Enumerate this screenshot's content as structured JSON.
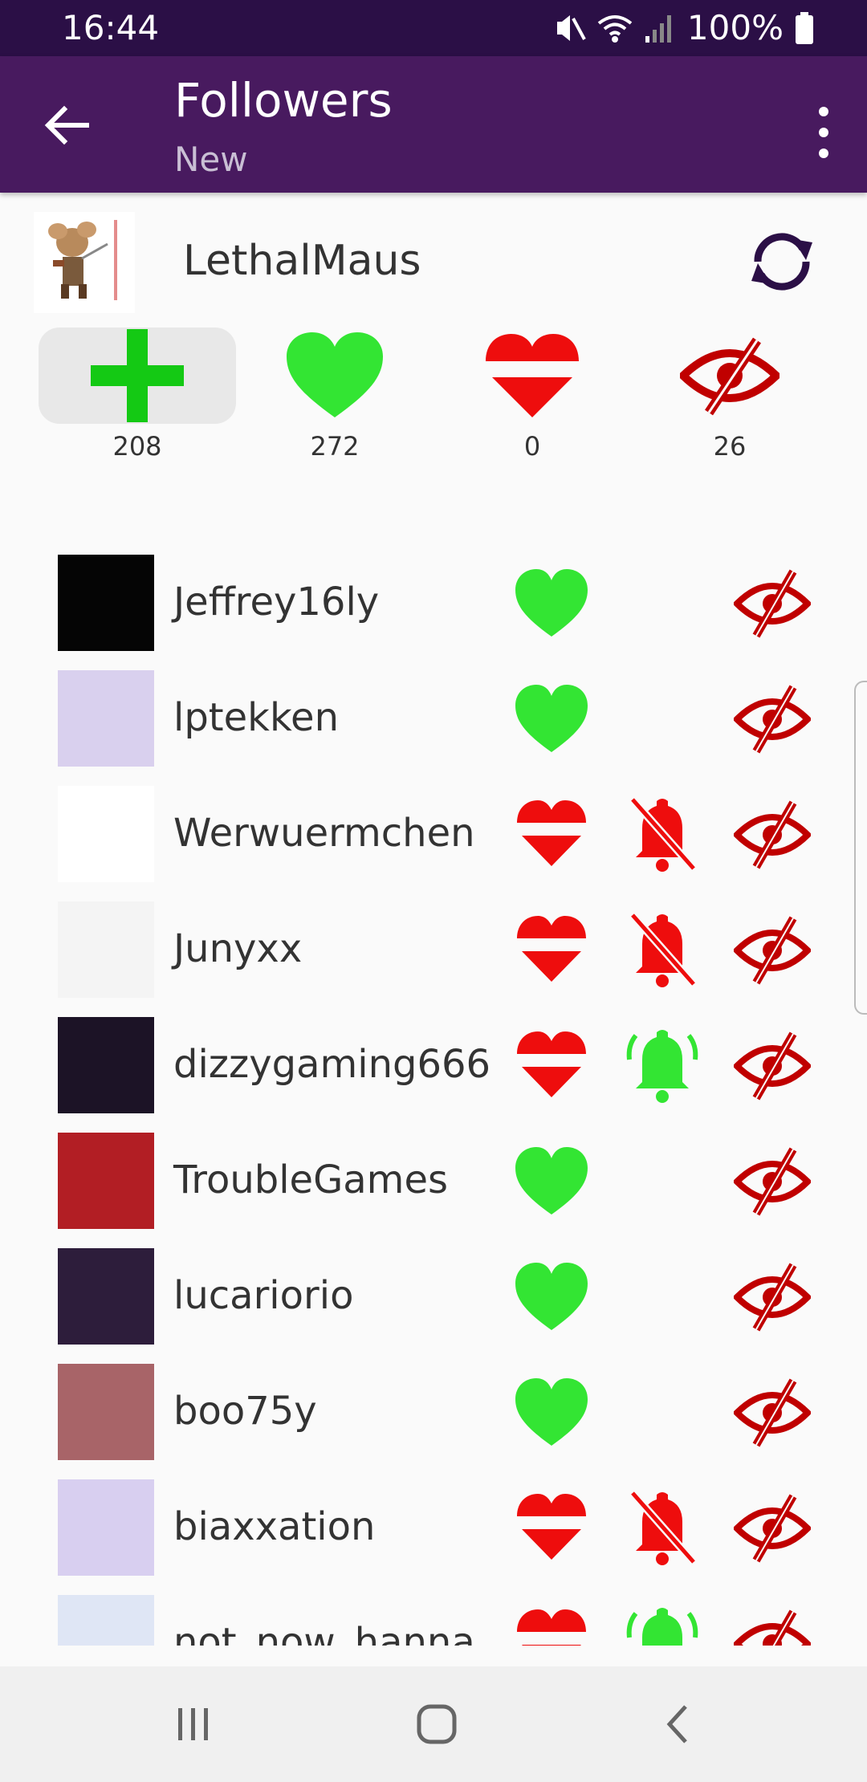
{
  "status_bar": {
    "time": "16:44",
    "battery": "100%"
  },
  "app_bar": {
    "title": "Followers",
    "subtitle": "New"
  },
  "profile": {
    "name": "LethalMaus",
    "stats": [
      {
        "key": "new",
        "count": "208"
      },
      {
        "key": "following-back",
        "count": "272"
      },
      {
        "key": "not-following",
        "count": "0"
      },
      {
        "key": "excluded",
        "count": "26"
      }
    ]
  },
  "followers": [
    {
      "name": "Jeffrey16ly",
      "heart": "follow",
      "bell": "none",
      "avatar_color": "#050505"
    },
    {
      "name": "lptekken",
      "heart": "follow",
      "bell": "none",
      "avatar_color": "#d9d0ee"
    },
    {
      "name": "Werwuermchen",
      "heart": "unfollow",
      "bell": "off",
      "avatar_color": "#ffffff"
    },
    {
      "name": "Junyxx",
      "heart": "unfollow",
      "bell": "off",
      "avatar_color": "#f4f4f4"
    },
    {
      "name": "dizzygaming666",
      "heart": "unfollow",
      "bell": "on",
      "avatar_color": "#1c1326"
    },
    {
      "name": "TroubleGames",
      "heart": "follow",
      "bell": "none",
      "avatar_color": "#b21e24"
    },
    {
      "name": "lucariorio",
      "heart": "follow",
      "bell": "none",
      "avatar_color": "#2d1d3b"
    },
    {
      "name": "boo75y",
      "heart": "follow",
      "bell": "none",
      "avatar_color": "#a86468"
    },
    {
      "name": "biaxxation",
      "heart": "unfollow",
      "bell": "off",
      "avatar_color": "#d8cff0"
    },
    {
      "name": "not_now_hanna",
      "heart": "unfollow",
      "bell": "on",
      "avatar_color": "#dfe6f5"
    }
  ],
  "colors": {
    "status_bar": "#2b0f46",
    "app_bar": "#481a5f",
    "green": "#33e533",
    "red": "#ee0d0d",
    "dark_red": "#c00000"
  }
}
